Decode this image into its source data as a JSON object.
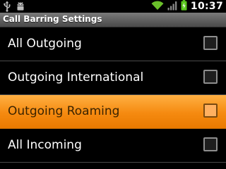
{
  "status_bar": {
    "time": "10:37",
    "icons": [
      "usb-icon",
      "android-debug-icon",
      "wifi-icon",
      "signal-icon",
      "battery-charging-icon"
    ]
  },
  "title_bar": {
    "title": "Call Barring Settings"
  },
  "settings": {
    "items": [
      {
        "label": "All Outgoing",
        "checked": false,
        "selected": false
      },
      {
        "label": "Outgoing International",
        "checked": false,
        "selected": false
      },
      {
        "label": "Outgoing Roaming",
        "checked": false,
        "selected": true
      },
      {
        "label": "All Incoming",
        "checked": false,
        "selected": false
      }
    ]
  },
  "colors": {
    "background": "#000000",
    "highlight": "#f58a10",
    "wifi": "#6abf2a",
    "battery": "#5ac81e"
  }
}
